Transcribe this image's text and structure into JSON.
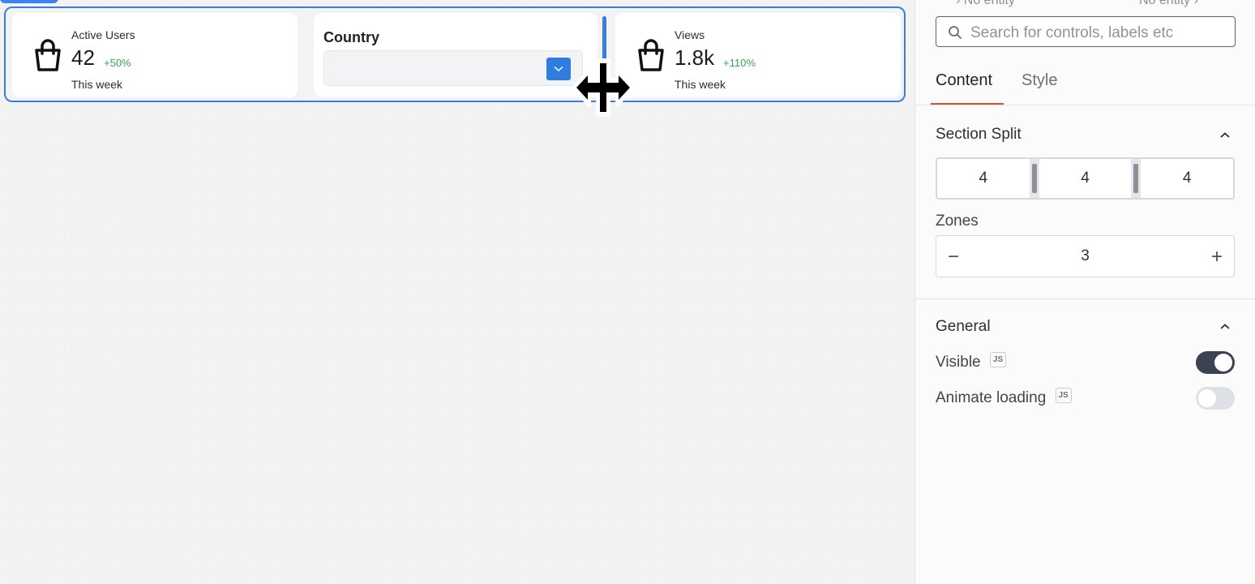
{
  "canvas": {
    "cards": [
      {
        "label": "Active Users",
        "value": "42",
        "change": "+50%",
        "sub": "This week"
      },
      {
        "label": "Country"
      },
      {
        "label": "Views",
        "value": "1.8k",
        "change": "+110%",
        "sub": "This week"
      }
    ]
  },
  "panel": {
    "entity_left": "No entity",
    "entity_right": "No entity",
    "search_placeholder": "Search for controls, labels etc",
    "tabs": [
      {
        "label": "Content"
      },
      {
        "label": "Style"
      }
    ],
    "section_split": {
      "title": "Section Split",
      "values": [
        "4",
        "4",
        "4"
      ],
      "zones_label": "Zones",
      "zones_value": "3",
      "minus": "−",
      "plus": "+"
    },
    "general": {
      "title": "General",
      "visible_label": "Visible",
      "visible_on": true,
      "animate_label": "Animate loading",
      "animate_on": false,
      "js_badge": "JS"
    }
  },
  "colors": {
    "accent_blue": "#3b7ddd",
    "positive_green": "#2fa84f",
    "tab_underline": "#d1552f",
    "toggle_on": "#3c4350"
  }
}
